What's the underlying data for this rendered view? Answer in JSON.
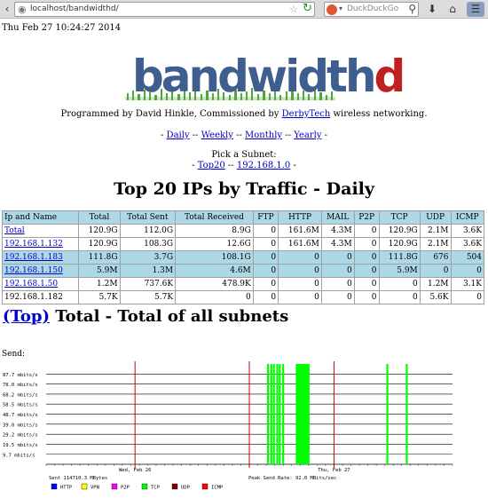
{
  "browser": {
    "url": "localhost/bandwidthd/",
    "search_engine": "DuckDuckGo"
  },
  "page": {
    "datetime": "Thu Feb 27 10:24:27 2014",
    "logo_text_main": "bandwidth",
    "logo_text_accent": "d",
    "credit_before": "Programmed by David Hinkle, Commissioned by",
    "credit_link": "DerbyTech",
    "credit_after": "wireless networking.",
    "period_links": [
      "Daily",
      "Weekly",
      "Monthly",
      "Yearly"
    ],
    "pick_subnet_label": "Pick a Subnet:",
    "subnet_links": [
      "Top20",
      "192.168.1.0"
    ],
    "report_title": "Top 20 IPs by Traffic - Daily",
    "subnet_section_link": "(Top)",
    "subnet_section_title": "Total - Total of all subnets",
    "send_label": "Send:"
  },
  "table": {
    "headers": [
      "Ip and Name",
      "Total",
      "Total Sent",
      "Total Received",
      "FTP",
      "HTTP",
      "MAIL",
      "P2P",
      "TCP",
      "UDP",
      "ICMP"
    ],
    "rows": [
      [
        "Total",
        "120.9G",
        "112.0G",
        "8.9G",
        "0",
        "161.6M",
        "4.3M",
        "0",
        "120.9G",
        "2.1M",
        "3.6K"
      ],
      [
        "192.168.1.132",
        "120.9G",
        "108.3G",
        "12.6G",
        "0",
        "161.6M",
        "4.3M",
        "0",
        "120.9G",
        "2.1M",
        "3.6K"
      ],
      [
        "192.168.1.183",
        "111.8G",
        "3.7G",
        "108.1G",
        "0",
        "0",
        "0",
        "0",
        "111.8G",
        "676",
        "504"
      ],
      [
        "192.168.1.150",
        "5.9M",
        "1.3M",
        "4.6M",
        "0",
        "0",
        "0",
        "0",
        "5.9M",
        "0",
        "0"
      ],
      [
        "192.168.1.50",
        "1.2M",
        "737.6K",
        "478.9K",
        "0",
        "0",
        "0",
        "0",
        "0",
        "1.2M",
        "3.1K"
      ],
      [
        "192.168.1.182",
        "5.7K",
        "5.7K",
        "0",
        "0",
        "0",
        "0",
        "0",
        "0",
        "5.6K",
        "0"
      ]
    ],
    "linked_rows": [
      0,
      1,
      2,
      3,
      4
    ],
    "row_shading": [
      false,
      false,
      true,
      true,
      false,
      false
    ]
  },
  "chart_data": {
    "type": "bar",
    "title": "",
    "ylabel": "",
    "y_ticks": [
      "87.7 mbits/s",
      "78.0 mbits/s",
      "68.2 mbits/s",
      "58.5 mbits/s",
      "48.7 mbits/s",
      "39.0 mbits/s",
      "29.2 mbits/s",
      "19.5 mbits/s",
      "9.7 mbits/s"
    ],
    "y_tick_values": [
      87.7,
      78.0,
      68.2,
      58.5,
      48.7,
      39.0,
      29.2,
      19.5,
      9.7
    ],
    "ylim": [
      0,
      97.5
    ],
    "x_ticks": [
      "Wed, Feb 26",
      "Thu, Feb 27"
    ],
    "x_tick_hours": [
      10.5,
      34
    ],
    "xlim_hours": [
      0,
      48
    ],
    "midnight_hours": [
      0,
      10.5,
      24,
      34,
      48
    ],
    "bars": [
      {
        "x": 26.2,
        "value": 97.5,
        "series": "TCP"
      },
      {
        "x": 26.6,
        "value": 97.5,
        "series": "TCP"
      },
      {
        "x": 26.9,
        "value": 97.5,
        "series": "TCP"
      },
      {
        "x": 27.3,
        "value": 97.5,
        "series": "TCP"
      },
      {
        "x": 27.6,
        "value": 97.5,
        "series": "TCP"
      },
      {
        "x": 28.0,
        "value": 97.5,
        "series": "TCP"
      },
      {
        "x": 29.6,
        "value": 97.5,
        "series": "TCP"
      },
      {
        "x": 29.8,
        "value": 97.5,
        "series": "TCP"
      },
      {
        "x": 30.0,
        "value": 97.5,
        "series": "TCP"
      },
      {
        "x": 30.2,
        "value": 97.5,
        "series": "TCP"
      },
      {
        "x": 30.4,
        "value": 97.5,
        "series": "TCP"
      },
      {
        "x": 30.6,
        "value": 97.5,
        "series": "TCP"
      },
      {
        "x": 30.8,
        "value": 97.5,
        "series": "TCP"
      },
      {
        "x": 31.0,
        "value": 97.5,
        "series": "TCP"
      },
      {
        "x": 40.3,
        "value": 97.5,
        "series": "TCP"
      },
      {
        "x": 42.6,
        "value": 97.5,
        "series": "TCP"
      }
    ],
    "sent_text": "Sent 114710.3 MBytes",
    "peak_text": "Peak Send Rate: 92.0 MBits/sec",
    "legend": [
      {
        "name": "HTTP",
        "color": "#0000ff"
      },
      {
        "name": "VPN",
        "color": "#ffff00"
      },
      {
        "name": "P2P",
        "color": "#ff00ff"
      },
      {
        "name": "TCP",
        "color": "#00ff00"
      },
      {
        "name": "UDP",
        "color": "#800000"
      },
      {
        "name": "ICMP",
        "color": "#ff0000"
      }
    ],
    "colors": {
      "grid": "#000000",
      "midnight": "#cc0000",
      "tcp": "#00ff00"
    }
  }
}
